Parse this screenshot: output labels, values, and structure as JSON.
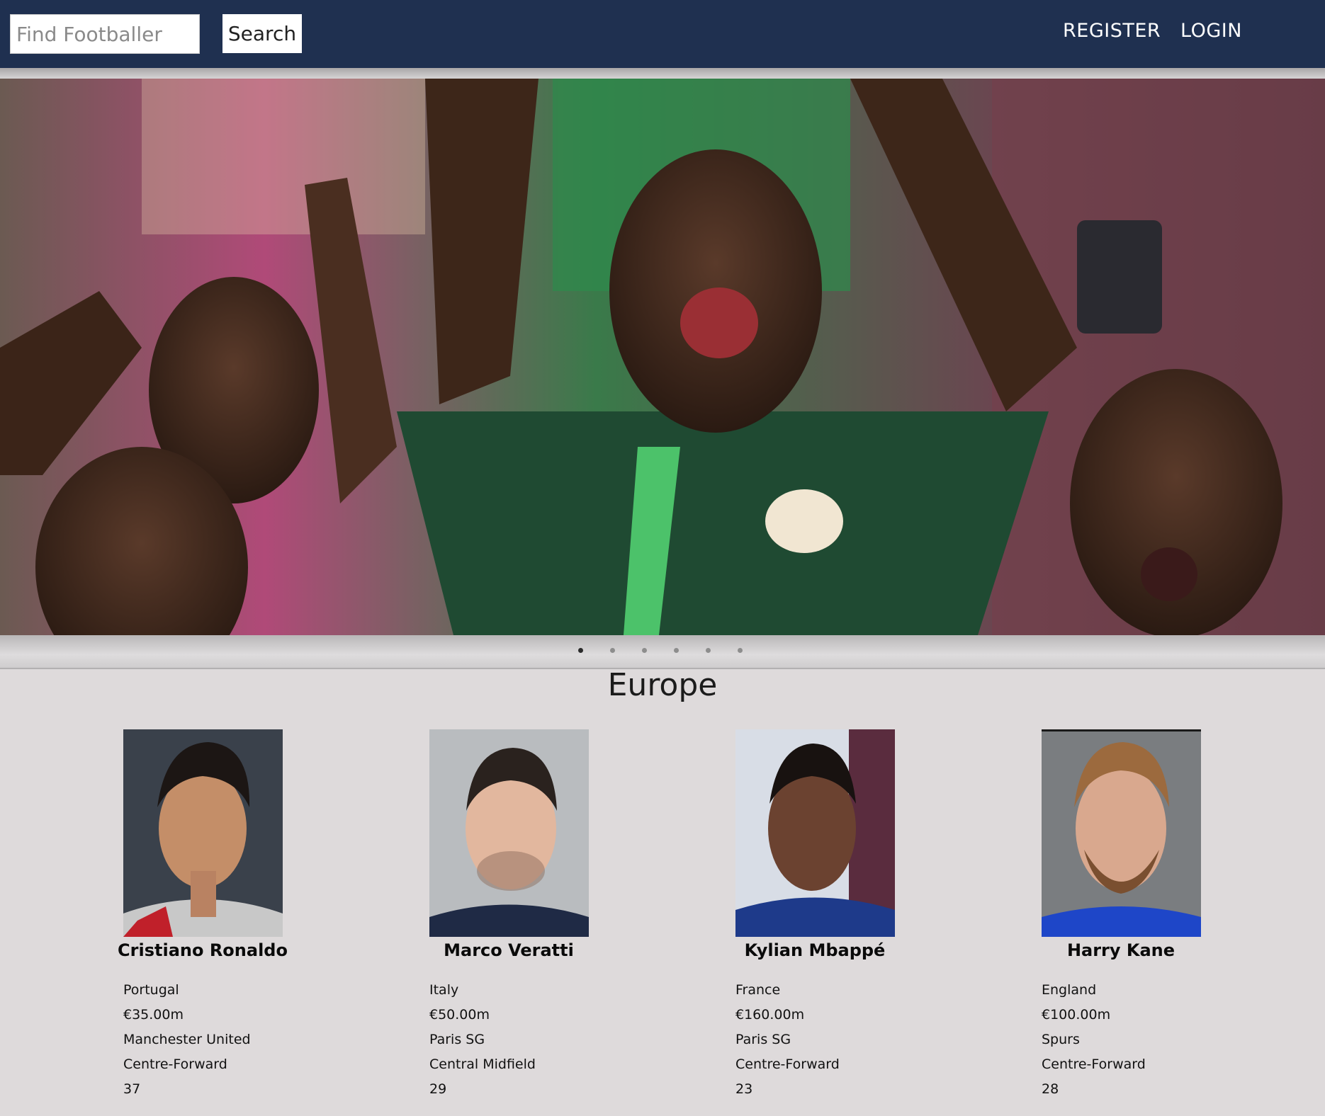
{
  "search": {
    "placeholder": "Find Footballer",
    "value": "",
    "button_label": "Search"
  },
  "nav": {
    "register_label": "REGISTER",
    "login_label": "LOGIN"
  },
  "carousel": {
    "slide_count": 6,
    "active_index": 0
  },
  "section": {
    "title": "Europe"
  },
  "players": [
    {
      "name": "Cristiano Ronaldo",
      "country": "Portugal",
      "value": "€35.00m",
      "club": "Manchester United",
      "position": "Centre-Forward",
      "age": "37"
    },
    {
      "name": "Marco Veratti",
      "country": "Italy",
      "value": "€50.00m",
      "club": "Paris SG",
      "position": "Central Midfield",
      "age": "29"
    },
    {
      "name": "Kylian Mbappé",
      "country": "France",
      "value": "€160.00m",
      "club": "Paris SG",
      "position": "Centre-Forward",
      "age": "23"
    },
    {
      "name": "Harry Kane",
      "country": "England",
      "value": "€100.00m",
      "club": "Spurs",
      "position": "Centre-Forward",
      "age": "28"
    }
  ],
  "colors": {
    "header": "#1f3050",
    "page_background": "#dedadb"
  }
}
